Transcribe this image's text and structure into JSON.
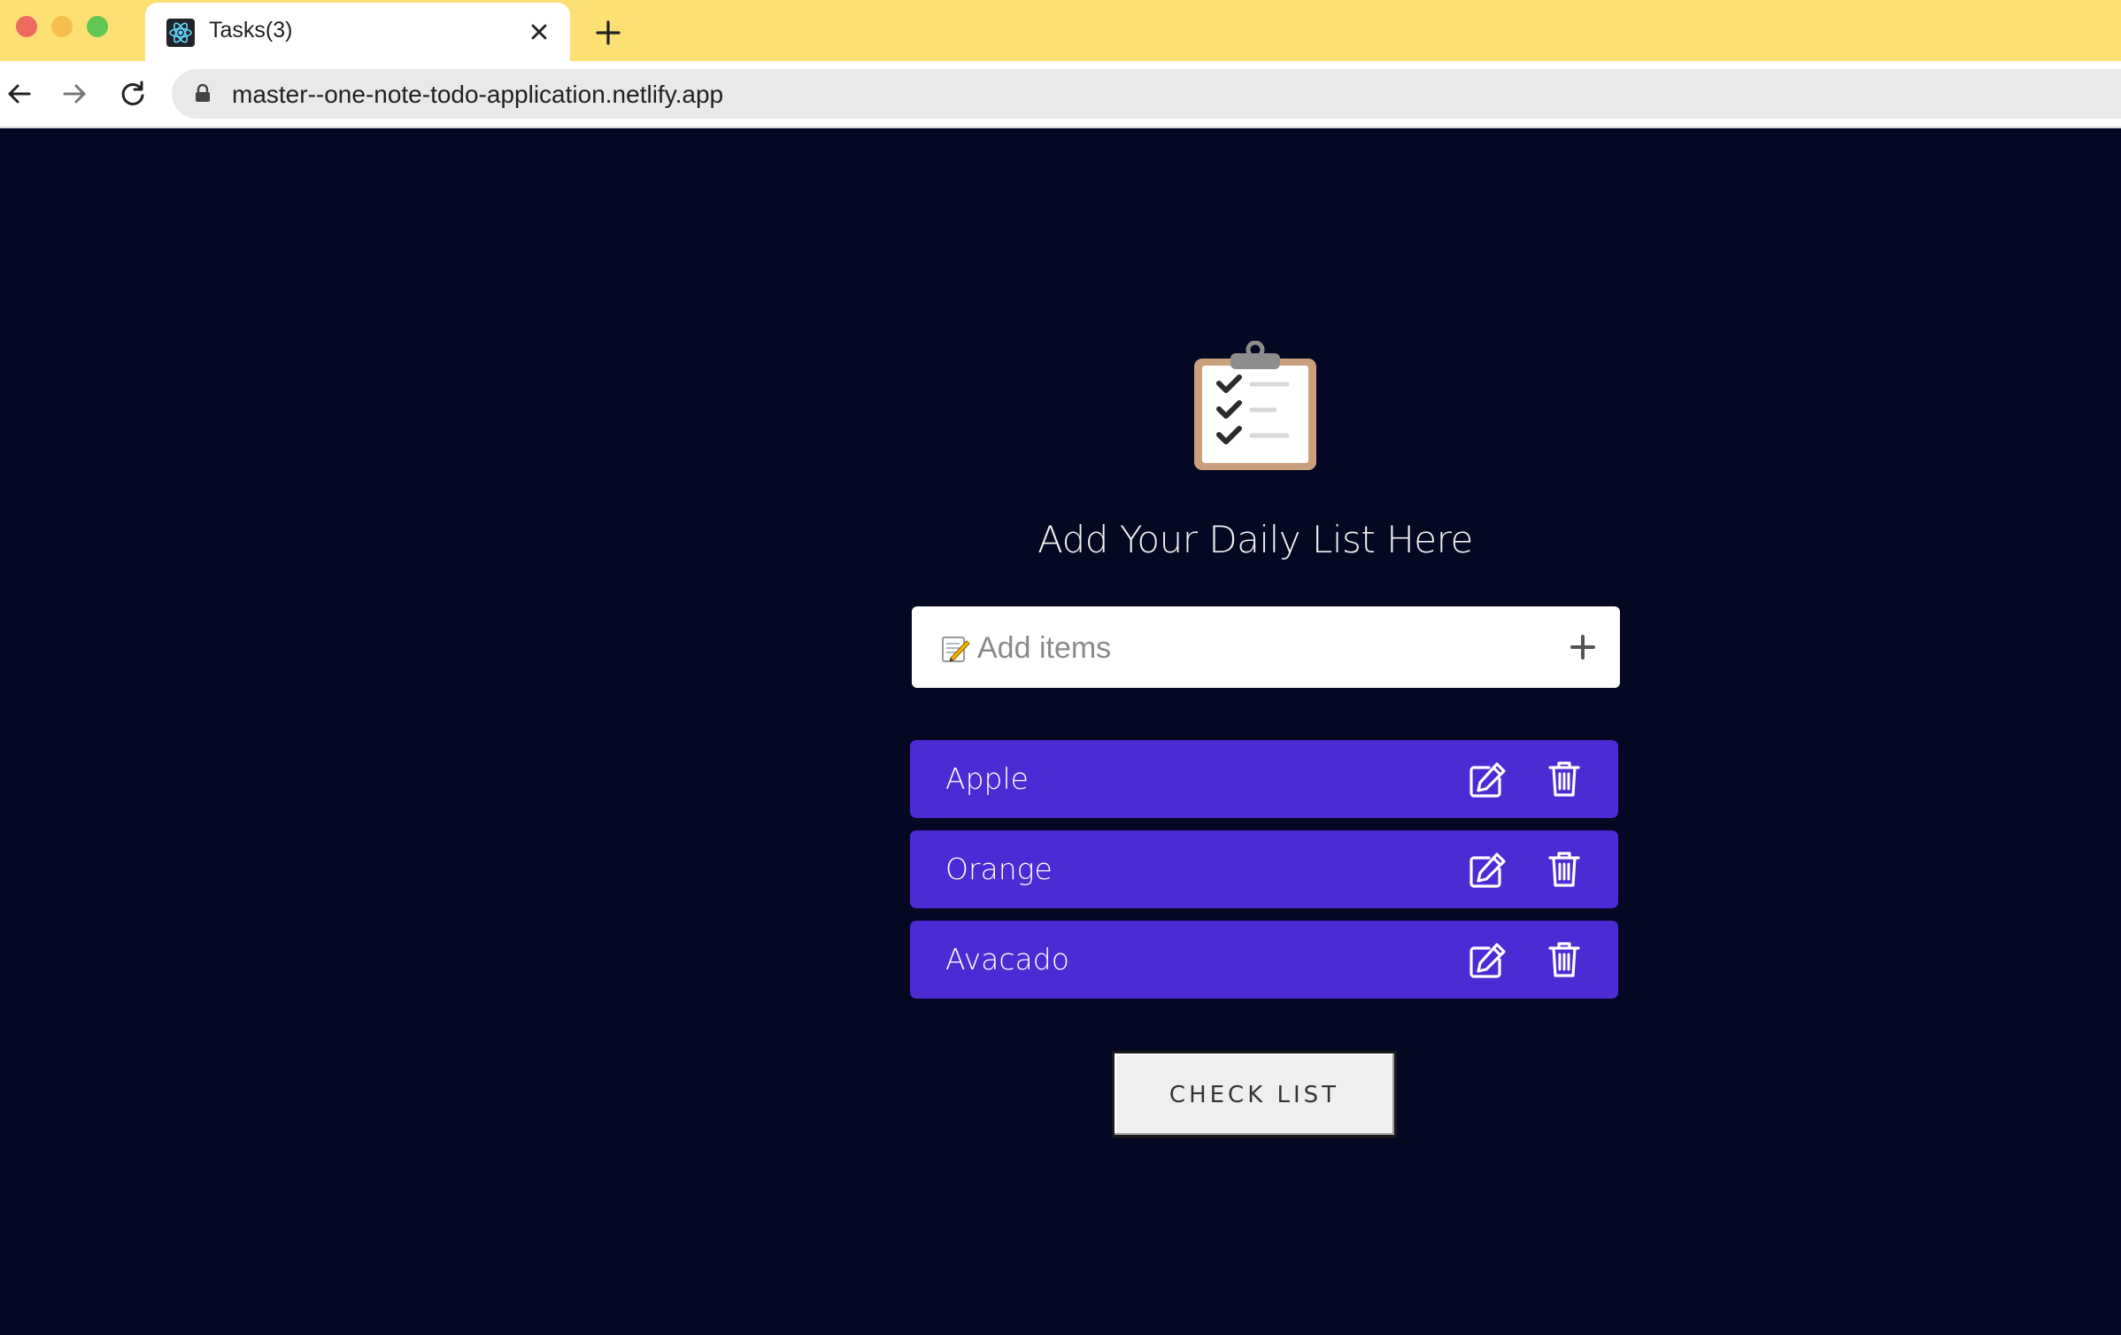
{
  "browser": {
    "tab": {
      "title": "Tasks(3)",
      "favicon": "react-atom-icon"
    },
    "url": "master--one-note-todo-application.netlify.app"
  },
  "app": {
    "heading": "Add Your Daily List Here",
    "input": {
      "placeholder": "Add items",
      "value": ""
    },
    "items": [
      {
        "label": "Apple"
      },
      {
        "label": "Orange"
      },
      {
        "label": "Avacado"
      }
    ],
    "check_list_button": "CHECK LIST"
  },
  "colors": {
    "page_background": "#050822",
    "item_background": "#4c2ad4",
    "titlebar": "#fde073"
  },
  "icons": [
    "clipboard-icon",
    "memo-icon",
    "plus-icon",
    "edit-icon",
    "trash-icon"
  ]
}
